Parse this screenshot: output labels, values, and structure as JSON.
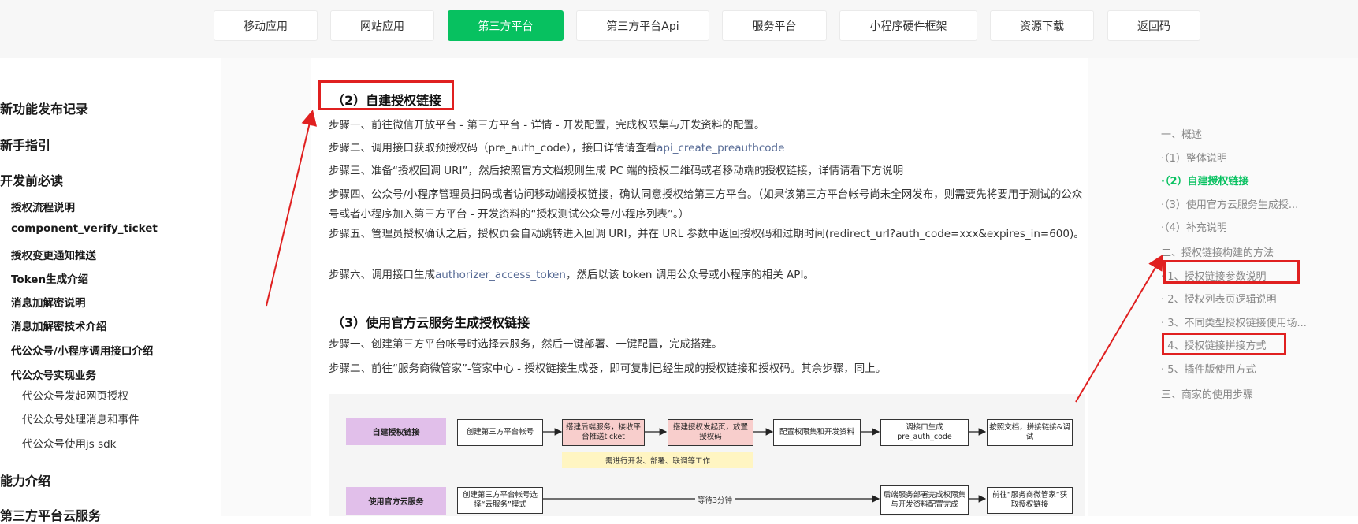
{
  "nav": {
    "tabs": [
      "移动应用",
      "网站应用",
      "第三方平台",
      "第三方平台Api",
      "服务平台",
      "小程序硬件框架",
      "资源下载",
      "返回码"
    ]
  },
  "sidebar": {
    "h1_items": [
      "新功能发布记录",
      "新手指引",
      "开发前必读",
      "能力介绍",
      "第三方平台云服务"
    ],
    "h2_items": [
      "授权流程说明",
      "component_verify_ticket",
      "授权变更通知推送",
      "Token生成介绍",
      "消息加解密说明",
      "消息加解密技术介绍",
      "代公众号/小程序调用接口介绍",
      "代公众号实现业务"
    ],
    "h3_items": [
      "代公众号发起网页授权",
      "代公众号处理消息和事件",
      "代公众号使用js sdk"
    ]
  },
  "content": {
    "section2_title": "（2）自建授权链接",
    "s2_step1": "步骤一、前往微信开放平台 - 第三方平台 - 详情 - 开发配置，完成权限集与开发资料的配置。",
    "s2_step2_pre": "步骤二、调用接口获取预授权码（pre_auth_code），接口详情请查看",
    "s2_step2_link": "api_create_preauthcode",
    "s2_step3": "步骤三、准备“授权回调 URI”，然后按照官方文档规则生成 PC 端的授权二维码或者移动端的授权链接，详情请看下方说明",
    "s2_step4": "步骤四、公众号/小程序管理员扫码或者访问移动端授权链接，确认同意授权给第三方平台。（如果该第三方平台帐号尚未全网发布，则需要先将要用于测试的公众号或者小程序加入第三方平台 - 开发资料的“授权测试公众号/小程序列表”。）",
    "s2_step5": "步骤五、管理员授权确认之后，授权页会自动跳转进入回调 URI，并在 URL 参数中返回授权码和过期时间(redirect_url?auth_code=xxx&expires_in=600)。",
    "s2_step6_pre": "步骤六、调用接口生成",
    "s2_step6_link": "authorizer_access_token",
    "s2_step6_post": "，然后以该 token 调用公众号或小程序的相关 API。",
    "section3_title": "（3）使用官方云服务生成授权链接",
    "s3_step1": "步骤一、创建第三方平台帐号时选择云服务，然后一键部署、一键配置，完成搭建。",
    "s3_step2": "步骤二、前往“服务商微管家”-管家中心 - 授权链接生成器，即可复制已经生成的授权链接和授权码。其余步骤，同上。"
  },
  "diagram": {
    "row1_label": "自建授权链接",
    "row1_boxes": [
      "创建第三方平台帐号",
      "搭建后端服务，接收平台推送ticket",
      "搭建授权发起页，放置授权码",
      "配置权限集和开发资料",
      "调接口生成pre_auth_code",
      "按照文档，拼接链接&调试"
    ],
    "row1_note": "需进行开发、部署、联调等工作",
    "row2_label": "使用官方云服务",
    "row2_boxes": [
      "创建第三方平台帐号选择“云服务”模式",
      "后端服务部署完成权限集与开发资料配置完成",
      "前往“服务商微管家”获取授权链接"
    ],
    "row2_wait": "等待3分钟"
  },
  "toc": {
    "items": [
      "一、概述",
      "·（1）整体说明",
      "·（2）自建授权链接",
      "·（3）使用官方云服务生成授...",
      "·（4）补充说明",
      "二、授权链接构建的方法",
      "· 1、授权链接参数说明",
      "· 2、授权列表页逻辑说明",
      "· 3、不同类型授权链接使用场...",
      "· 4、授权链接拼接方式",
      "· 5、插件版使用方式",
      "三、商家的使用步骤"
    ]
  },
  "colors": {
    "accent": "#07c160",
    "annotation": "#e02020",
    "link": "#576b95"
  }
}
